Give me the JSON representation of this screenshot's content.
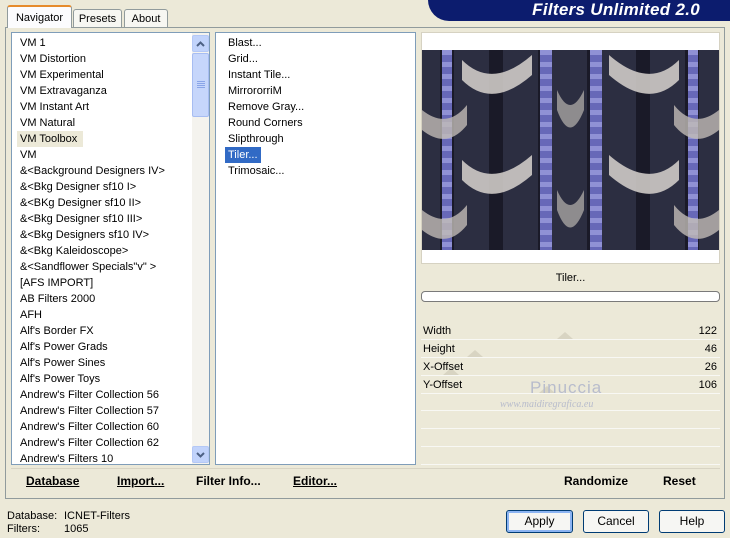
{
  "banner": {
    "title": "Filters Unlimited 2.0"
  },
  "tabs": [
    {
      "label": "Navigator"
    },
    {
      "label": "Presets"
    },
    {
      "label": "About"
    }
  ],
  "categories": {
    "items": [
      "VM 1",
      "VM Distortion",
      "VM Experimental",
      "VM Extravaganza",
      "VM Instant Art",
      "VM Natural",
      "VM Toolbox",
      "VM",
      "&<Background Designers IV>",
      "&<Bkg Designer sf10 I>",
      "&<BKg Designer sf10 II>",
      "&<Bkg Designer sf10 III>",
      "&<Bkg Designers sf10 IV>",
      "&<Bkg Kaleidoscope>",
      "&<Sandflower Specials\"v\" >",
      "[AFS IMPORT]",
      "AB Filters 2000",
      "AFH",
      "Alf's Border FX",
      "Alf's Power Grads",
      "Alf's Power Sines",
      "Alf's Power Toys",
      "Andrew's Filter Collection 56",
      "Andrew's Filter Collection 57",
      "Andrew's Filter Collection 60",
      "Andrew's Filter Collection 62",
      "Andrew's Filters 10"
    ],
    "selected": "VM Toolbox"
  },
  "filters": {
    "items": [
      "Blast...",
      "Grid...",
      "Instant Tile...",
      "MirrororriM",
      "Remove Gray...",
      "Round Corners",
      "Slipthrough",
      "Tiler...",
      "Trimosaic..."
    ],
    "selected": "Tiler..."
  },
  "preview": {
    "filter_name": "Tiler..."
  },
  "params": [
    {
      "label": "Width",
      "value": "122",
      "level": 0.48
    },
    {
      "label": "Height",
      "value": "46",
      "level": 0.18
    },
    {
      "label": "X-Offset",
      "value": "26",
      "level": 0.1
    },
    {
      "label": "Y-Offset",
      "value": "106",
      "level": 0.42
    }
  ],
  "watermark": {
    "name": "Pinuccia",
    "site": "www.maidiregrafica.eu"
  },
  "toolbar": {
    "database": "Database",
    "import": "Import...",
    "filter_info": "Filter Info...",
    "editor": "Editor...",
    "randomize": "Randomize",
    "reset": "Reset"
  },
  "status": {
    "database_label": "Database:",
    "database_value": "ICNET-Filters",
    "filters_label": "Filters:",
    "filters_value": "1065"
  },
  "buttons": {
    "apply": "Apply",
    "cancel": "Cancel",
    "help": "Help"
  },
  "colors": {
    "selection": "#316ac5",
    "banner": "#0c1c6e",
    "face": "#ece9d8"
  }
}
